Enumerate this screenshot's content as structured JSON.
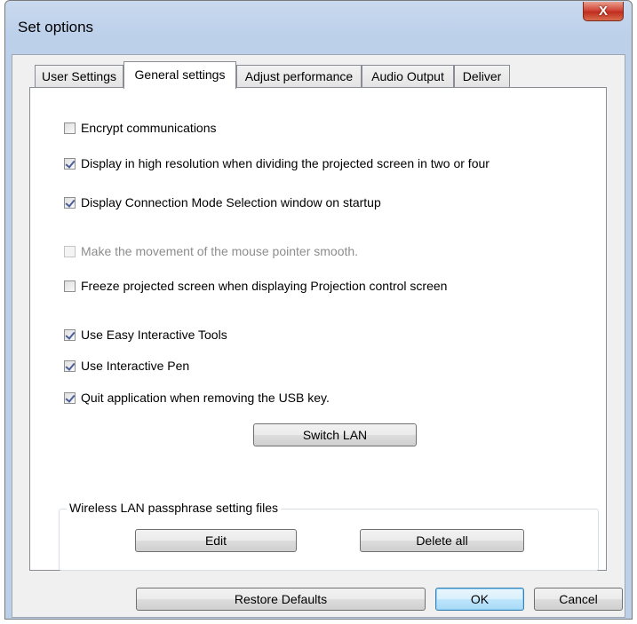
{
  "window": {
    "title": "Set options",
    "close_label": "X"
  },
  "tabs": [
    {
      "label": "User Settings",
      "active": false
    },
    {
      "label": "General settings",
      "active": true
    },
    {
      "label": "Adjust performance",
      "active": false
    },
    {
      "label": "Audio Output",
      "active": false
    },
    {
      "label": "Deliver",
      "active": false
    }
  ],
  "options": [
    {
      "label": "Encrypt communications",
      "checked": false,
      "enabled": true
    },
    {
      "label": "Display in high resolution when dividing the projected screen in two or four",
      "checked": true,
      "enabled": true
    },
    {
      "label": "Display Connection Mode Selection window on startup",
      "checked": true,
      "enabled": true
    },
    {
      "label": "Make the movement of the mouse pointer smooth.",
      "checked": false,
      "enabled": false
    },
    {
      "label": "Freeze projected screen when displaying Projection control screen",
      "checked": false,
      "enabled": true
    },
    {
      "label": "Use Easy Interactive Tools",
      "checked": true,
      "enabled": true
    },
    {
      "label": "Use Interactive Pen",
      "checked": true,
      "enabled": true
    },
    {
      "label": "Quit application when removing the USB key.",
      "checked": true,
      "enabled": true
    }
  ],
  "switch_lan_label": "Switch LAN",
  "passphrase_group": {
    "legend": "Wireless LAN passphrase setting files",
    "edit_label": "Edit",
    "delete_all_label": "Delete all"
  },
  "footer": {
    "restore_label": "Restore Defaults",
    "ok_label": "OK",
    "cancel_label": "Cancel"
  }
}
